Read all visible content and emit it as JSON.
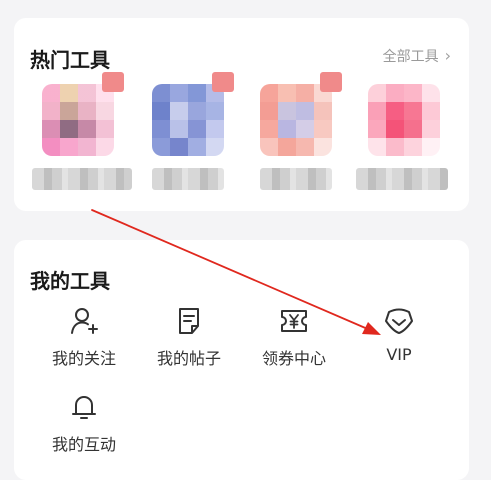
{
  "hot_tools": {
    "title": "热门工具",
    "all_link": "全部工具"
  },
  "my_tools": {
    "title": "我的工具",
    "items": [
      {
        "label": "我的关注",
        "icon": "person-add-icon"
      },
      {
        "label": "我的帖子",
        "icon": "post-note-icon"
      },
      {
        "label": "领券中心",
        "icon": "coupon-yen-icon"
      },
      {
        "label": "VIP",
        "icon": "vip-crown-icon"
      },
      {
        "label": "我的互动",
        "icon": "bell-icon"
      }
    ]
  },
  "colors": {
    "annotation_arrow": "#e0281e",
    "icon_stroke": "#333333"
  }
}
